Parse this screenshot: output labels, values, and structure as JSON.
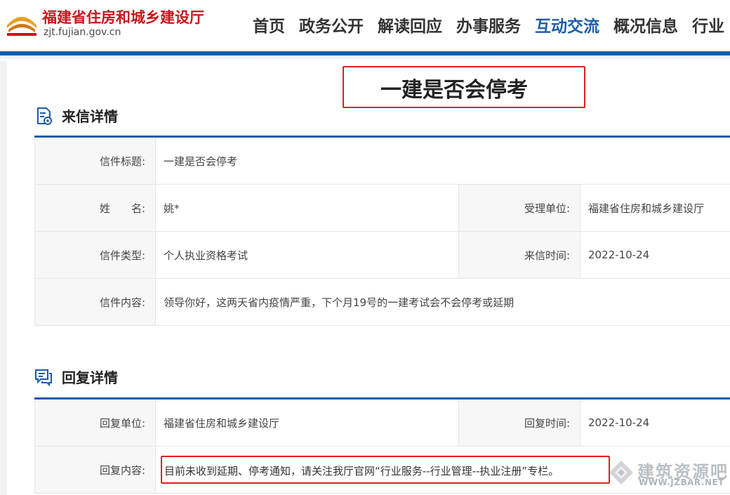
{
  "header": {
    "site_name": "福建省住房和城乡建设厅",
    "site_url": "zjt.fujian.gov.cn",
    "nav": [
      "首页",
      "政务公开",
      "解读回应",
      "办事服务",
      "互动交流",
      "概况信息",
      "行业"
    ],
    "active_nav": "互动交流",
    "colors": {
      "brand_red": "#c8161d",
      "nav_active": "#1f5ea8",
      "bar_blue": "#1d5ba7"
    }
  },
  "page": {
    "title": "一建是否会停考"
  },
  "letter": {
    "section_title": "来信详情",
    "title_label": "信件标题:",
    "title_value": "一建是否会停考",
    "name_label": "姓　　名:",
    "name_value": "姚*",
    "unit_label": "受理单位:",
    "unit_value": "福建省住房和城乡建设厅",
    "type_label": "信件类型:",
    "type_value": "个人执业资格考试",
    "time_label": "来信时间:",
    "time_value": "2022-10-24",
    "content_label": "信件内容:",
    "content_value": "领导你好，这两天省内疫情严重，下个月19号的一建考试会不会停考或延期"
  },
  "reply": {
    "section_title": "回复详情",
    "unit_label": "回复单位:",
    "unit_value": "福建省住房和城乡建设厅",
    "time_label": "回复时间:",
    "time_value": "2022-10-24",
    "content_label": "回复内容:",
    "content_value": "目前未收到延期、停考通知，请关注我厅官网“行业服务--行业管理--执业注册”专栏。"
  },
  "watermark": {
    "text": "建筑资源吧",
    "url": "WWW.JZBAR.NET"
  }
}
